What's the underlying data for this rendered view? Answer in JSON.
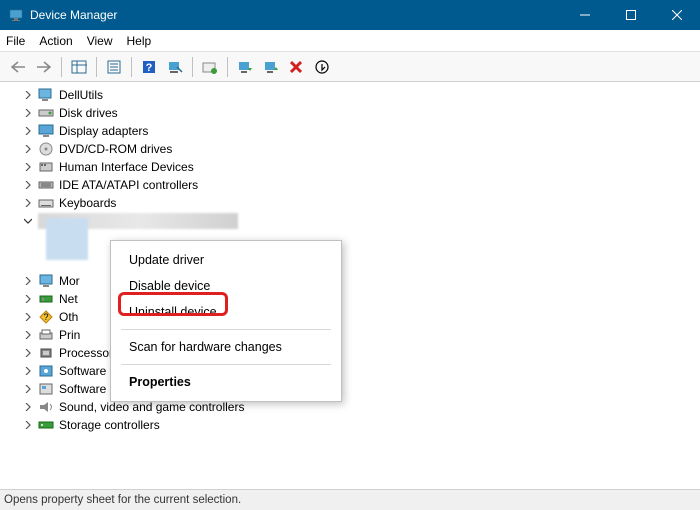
{
  "window": {
    "title": "Device Manager"
  },
  "menu": {
    "file": "File",
    "action": "Action",
    "view": "View",
    "help": "Help"
  },
  "tree": {
    "items": [
      "DellUtils",
      "Disk drives",
      "Display adapters",
      "DVD/CD-ROM drives",
      "Human Interface Devices",
      "IDE ATA/ATAPI controllers",
      "Keyboards"
    ],
    "partial": [
      "Mor",
      "Net",
      "Oth",
      "Prin",
      "Processors",
      "Software components",
      "Software devices",
      "Sound, video and game controllers",
      "Storage controllers"
    ]
  },
  "context": {
    "update": "Update driver",
    "disable": "Disable device",
    "uninstall": "Uninstall device",
    "scan": "Scan for hardware changes",
    "properties": "Properties"
  },
  "status": {
    "text": "Opens property sheet for the current selection."
  }
}
